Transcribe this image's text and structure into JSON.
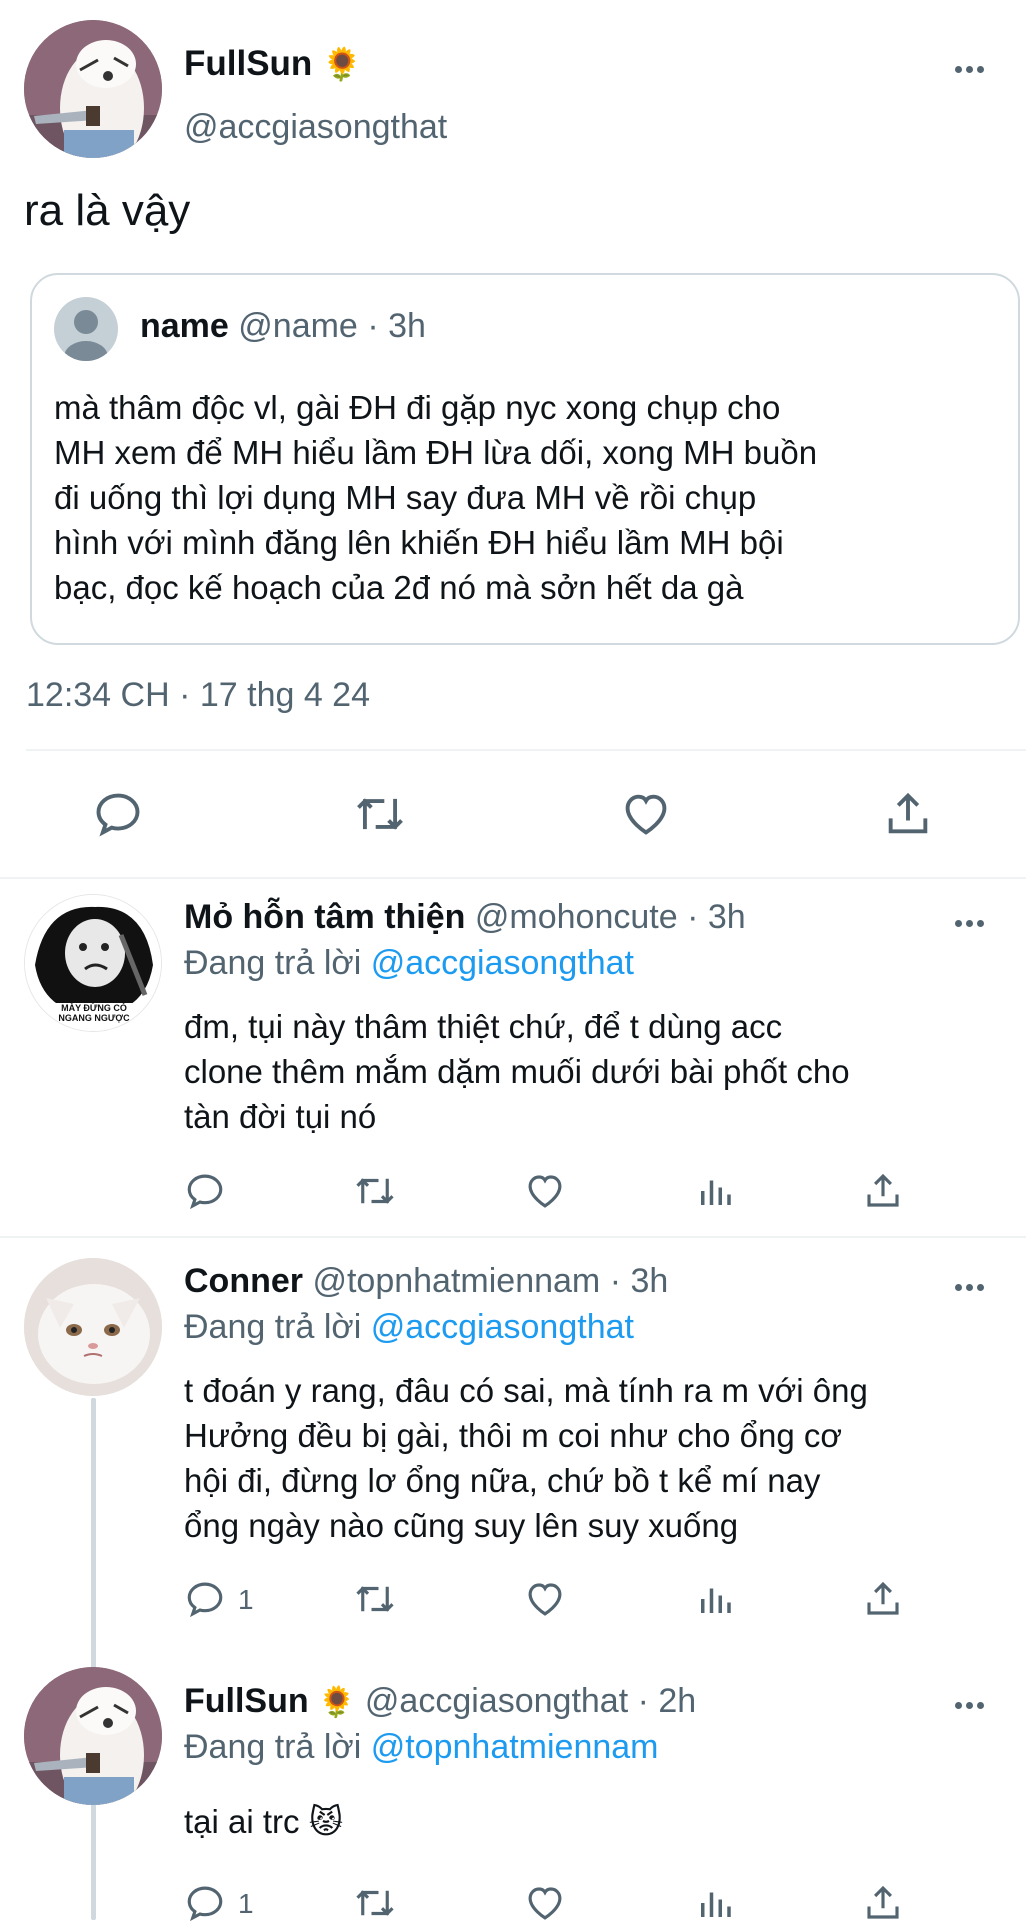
{
  "main_tweet": {
    "name": "FullSun",
    "name_emoji": "🌻",
    "handle": "@accgiasongthat",
    "text": "ra là vậy",
    "quote": {
      "name": "name",
      "handle": "@name",
      "time": "· 3h",
      "text": "mà thâm độc vl, gài ĐH đi gặp nyc xong chụp cho\nMH xem để MH hiểu lầm ĐH lừa dối, xong MH buồn\nđi uống thì lợi dụng MH say đưa MH về rồi chụp\nhình với mình đăng lên khiến ĐH hiểu lầm MH bội\nbạc, đọc kế hoạch của 2đ nó mà sởn hết da gà"
    },
    "timestamp": "12:34 CH · 17 thg 4 24"
  },
  "replies": [
    {
      "name": "Mỏ hỗn tâm thiện",
      "handle": "@mohoncute",
      "time": "· 3h",
      "replying_prefix": "Đang trả lời",
      "replying_to": "@accgiasongthat",
      "text": "đm, tụi này thâm thiệt chứ, để t dùng acc\nclone thêm mắm dặm muối dưới bài phốt cho\ntàn đời tụi nó",
      "avatar_caption": "MÀY ĐỪNG CÓ\nNGANG NGƯỢC"
    },
    {
      "name": "Conner",
      "handle": "@topnhatmiennam",
      "time": "· 3h",
      "replying_prefix": "Đang trả lời",
      "replying_to": "@accgiasongthat",
      "text": "t đoán y rang, đâu có sai, mà tính ra m với ông\nHưởng đều bị gài, thôi m coi như cho ổng cơ\nhội đi, đừng lơ ổng nữa, chứ bồ t kể mí nay\nổng ngày nào cũng suy lên suy xuống",
      "reply_count": "1"
    },
    {
      "name": "FullSun",
      "name_emoji": "🌻",
      "handle": "@accgiasongthat",
      "time": "· 2h",
      "replying_prefix": "Đang trả lời",
      "replying_to": "@topnhatmiennam",
      "text": "tại ai trc 😾",
      "reply_count": "1"
    }
  ],
  "colors": {
    "accent": "#1d9bf0",
    "secondary_text": "#536471",
    "primary_text": "#0f1419",
    "divider": "#eff3f4"
  },
  "icons": [
    "more-icon",
    "reply-icon",
    "retweet-icon",
    "like-icon",
    "views-icon",
    "share-icon",
    "default-avatar-icon"
  ]
}
